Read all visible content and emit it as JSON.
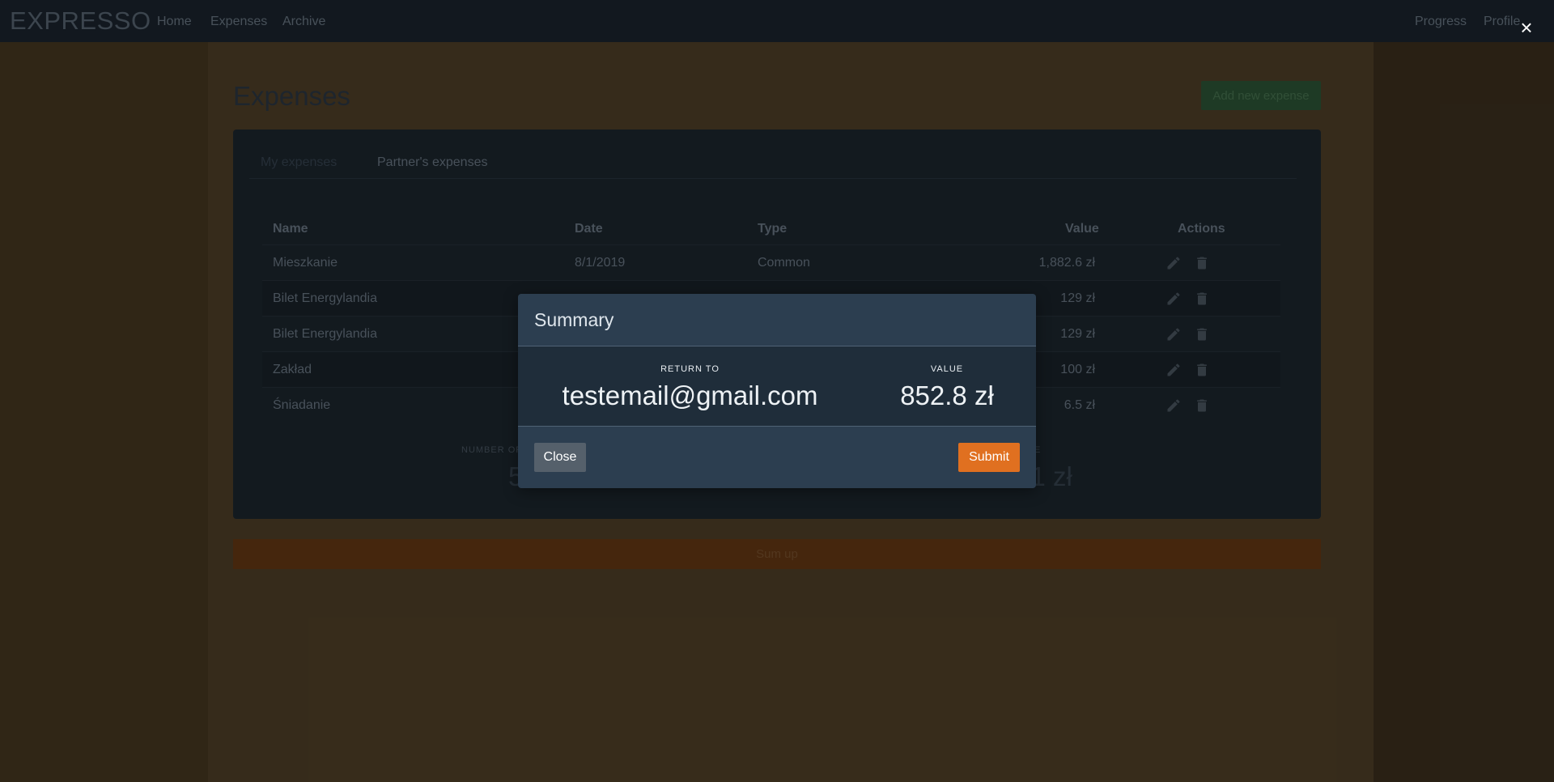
{
  "navbar": {
    "brand": "EXPRESSO",
    "links": [
      "Home",
      "Expenses",
      "Archive"
    ],
    "right": [
      "Progress",
      "Profile"
    ]
  },
  "page": {
    "title": "Expenses",
    "add_button": "Add new expense"
  },
  "tabs": [
    "My expenses",
    "Partner's expenses"
  ],
  "table": {
    "headers": [
      "Name",
      "Date",
      "Type",
      "Value",
      "Actions"
    ],
    "rows": [
      {
        "name": "Mieszkanie",
        "date": "8/1/2019",
        "type": "Common",
        "value": "1,882.6 zł"
      },
      {
        "name": "Bilet Energylandia",
        "date": "",
        "type": "",
        "value": "129 zł"
      },
      {
        "name": "Bilet Energylandia",
        "date": "",
        "type": "",
        "value": "129 zł"
      },
      {
        "name": "Zakład",
        "date": "",
        "type": "",
        "value": "100 zł"
      },
      {
        "name": "Śniadanie",
        "date": "",
        "type": "",
        "value": "6.5 zł"
      }
    ]
  },
  "stats": {
    "left_label": "NUMBER OF",
    "left_value": "5",
    "right_label": "LUE",
    "right_value": "7.1 zł"
  },
  "sum_up_button": "Sum up",
  "modal": {
    "title": "Summary",
    "return_label": "RETURN TO",
    "return_value": "testemail@gmail.com",
    "value_label": "VALUE",
    "value_value": "852.8 zł",
    "close_button": "Close",
    "submit_button": "Submit",
    "close_icon": "×"
  },
  "colors": {
    "submit": "#e07020",
    "modal_bg": "#2c3e50",
    "overlay_body": "#4a3b22"
  }
}
